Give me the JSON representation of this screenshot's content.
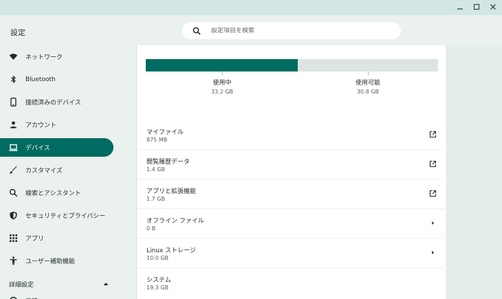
{
  "window": {
    "title": "設定",
    "controls": [
      "minimize-icon",
      "maximize-icon",
      "close-icon"
    ]
  },
  "search": {
    "placeholder": "設定項目を検索",
    "icon": "search-icon"
  },
  "sidebar": {
    "items": [
      {
        "label": "ネットワーク",
        "icon": "wifi-icon",
        "active": false
      },
      {
        "label": "Bluetooth",
        "icon": "bluetooth-icon",
        "active": false
      },
      {
        "label": "接続済みのデバイス",
        "icon": "phone-icon",
        "active": false
      },
      {
        "label": "アカウント",
        "icon": "person-icon",
        "active": false
      },
      {
        "label": "デバイス",
        "icon": "laptop-icon",
        "active": true
      },
      {
        "label": "カスタマイズ",
        "icon": "brush-icon",
        "active": false
      },
      {
        "label": "検索とアシスタント",
        "icon": "search-icon",
        "active": false
      },
      {
        "label": "セキュリティとプライバシー",
        "icon": "shield-icon",
        "active": false
      },
      {
        "label": "アプリ",
        "icon": "apps-grid-icon",
        "active": false
      },
      {
        "label": "ユーザー補助機能",
        "icon": "accessibility-icon",
        "active": false
      }
    ],
    "advanced": {
      "label": "詳細設定",
      "icon": "chevron-up-icon"
    },
    "partial_item": {
      "label": "日時"
    }
  },
  "storage": {
    "used_fraction": 0.52,
    "in_use": {
      "label": "使用中",
      "value": "33.2 GB"
    },
    "available": {
      "label": "使用可能",
      "value": "30.8 GB"
    },
    "rows": [
      {
        "name": "マイファイル",
        "size": "875 MB",
        "action": "external-link-icon"
      },
      {
        "name": "閲覧履歴データ",
        "size": "1.4 GB",
        "action": "external-link-icon"
      },
      {
        "name": "アプリと拡張機能",
        "size": "1.7 GB",
        "action": "external-link-icon"
      },
      {
        "name": "オフライン ファイル",
        "size": "0 B",
        "action": "chevron-right-icon"
      },
      {
        "name": "Linux ストレージ",
        "size": "10.0 GB",
        "action": "chevron-right-icon"
      },
      {
        "name": "システム",
        "size": "19.3 GB",
        "action": ""
      }
    ]
  },
  "colors": {
    "accent": "#006b60",
    "titlebar": "#d3e6e4",
    "sidebar_bg": "#eaf1ef",
    "bar_empty": "#dde5e3"
  }
}
